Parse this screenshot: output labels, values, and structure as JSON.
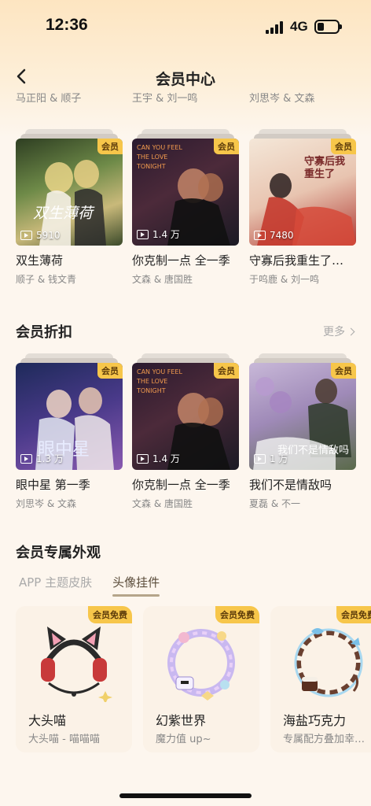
{
  "status_bar": {
    "time": "12:36",
    "network": "4G"
  },
  "nav": {
    "title": "会员中心"
  },
  "cutoff_cast": [
    "马正阳 & 顺子",
    "王宇 & 刘一鸣",
    "刘思岑 & 文森"
  ],
  "row1": [
    {
      "badge": "会员",
      "plays": "5910",
      "title": "双生薄荷",
      "cast": "顺子 & 钱文青",
      "cover_text": "双生薄荷"
    },
    {
      "badge": "会员",
      "plays": "1.4 万",
      "title": "你克制一点 全一季",
      "cast": "文森 & 唐国胜",
      "cover_text": "CAN YOU FEEL THE LOVE TONIGHT"
    },
    {
      "badge": "会员",
      "plays": "7480",
      "title": "守寡后我重生了…",
      "cast": "于呜鹿 & 刘一鸣",
      "cover_text": "守寡后我重生了"
    }
  ],
  "discount": {
    "title": "会员折扣",
    "more": "更多",
    "items": [
      {
        "badge": "会员",
        "plays": "1.3 万",
        "title": "眼中星 第一季",
        "cast": "刘思岑 & 文森",
        "cover_text": "眼中星"
      },
      {
        "badge": "会员",
        "plays": "1.4 万",
        "title": "你克制一点 全一季",
        "cast": "文森 & 唐国胜",
        "cover_text": "CAN YOU FEEL THE LOVE TONIGHT"
      },
      {
        "badge": "会员",
        "plays": "1 万",
        "title": "我们不是情敌吗",
        "cast": "夏磊 & 不一",
        "cover_text": "我们不是情敌吗"
      }
    ]
  },
  "appearance": {
    "title": "会员专属外观",
    "tabs": [
      "APP 主题皮肤",
      "头像挂件"
    ],
    "active_tab": "头像挂件",
    "frames": [
      {
        "badge": "会员免费",
        "name": "大头喵",
        "desc": "大头喵 - 喵喵喵",
        "icon": "cat-ear-headphones-frame-icon"
      },
      {
        "badge": "会员免费",
        "name": "幻紫世界",
        "desc": "魔力值 up~",
        "icon": "purple-fantasy-frame-icon"
      },
      {
        "badge": "会员免费",
        "name": "海盐巧克力",
        "desc": "专属配方叠加幸…",
        "icon": "sea-salt-chocolate-frame-icon"
      }
    ]
  },
  "colors": {
    "badge": "#f7c64a",
    "background": "#fdf6ee",
    "header_gradient": "#fde5c1"
  }
}
